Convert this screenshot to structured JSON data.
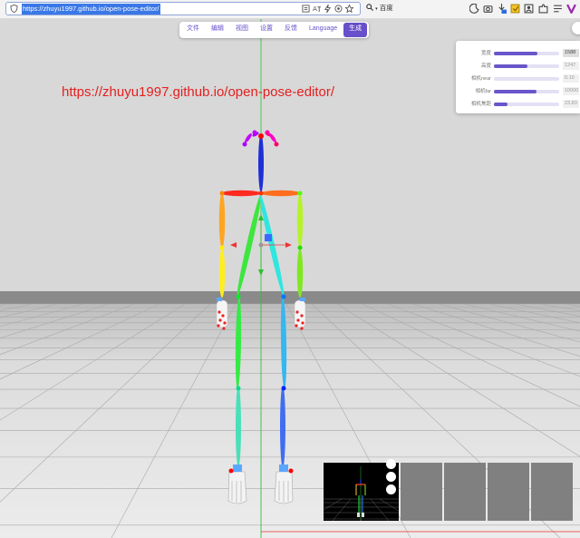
{
  "browser": {
    "url": "https://zhuyu1997.github.io/open-pose-editor/",
    "search_engine": "百度"
  },
  "menu": {
    "items": [
      {
        "label": "文件",
        "active": false
      },
      {
        "label": "编辑",
        "active": false
      },
      {
        "label": "视图",
        "active": false
      },
      {
        "label": "设置",
        "active": false
      },
      {
        "label": "反馈",
        "active": false
      },
      {
        "label": "Language",
        "active": false
      },
      {
        "label": "生成",
        "active": true
      }
    ]
  },
  "watermark_url": "https://zhuyu1997.github.io/open-pose-editor/",
  "settings": {
    "rows": [
      {
        "label": "宽度",
        "value": "1588",
        "fill": 0.66
      },
      {
        "label": "高度",
        "value": "1247",
        "fill": 0.52
      },
      {
        "label": "相机near",
        "value": "0.10",
        "fill": 0.0
      },
      {
        "label": "相机far",
        "value": "10000.00",
        "fill": 0.65
      },
      {
        "label": "相机焦距",
        "value": "23.83",
        "fill": 0.21
      }
    ]
  },
  "colors": {
    "accent": "#6750c9",
    "sky": "#d8d8d8",
    "floor": "#e6e6e6",
    "horizon": "#8a8a8a",
    "watermark": "#e41f1f"
  },
  "icons": {
    "address_bar": [
      "shield-icon",
      "reader-icon",
      "translate-icon",
      "lightning-icon",
      "extensions-icon",
      "star-icon"
    ],
    "toolbar": [
      "search-icon",
      "history-icon",
      "screenshot-icon",
      "download-icon",
      "notes-icon",
      "profile-icon",
      "puzzle-icon",
      "list-icon",
      "v-icon"
    ]
  }
}
